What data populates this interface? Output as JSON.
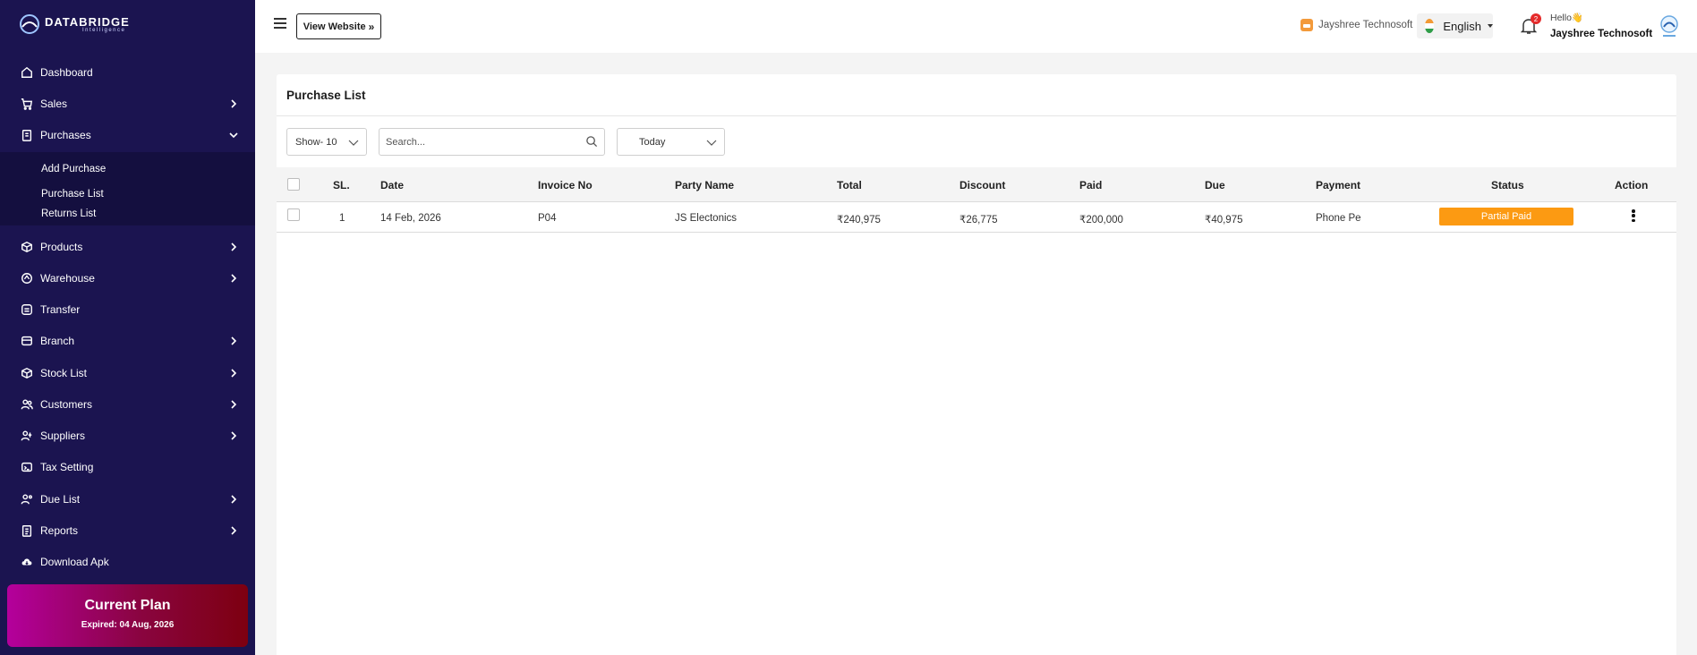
{
  "brand": {
    "name": "DATABRIDGE",
    "tagline": "Intelligence"
  },
  "sidebar": {
    "items": [
      {
        "label": "Dashboard",
        "icon": "home-icon"
      },
      {
        "label": "Sales",
        "icon": "cart-icon"
      },
      {
        "label": "Purchases",
        "icon": "clipboard-icon"
      },
      {
        "label": "Products",
        "icon": "box-icon"
      },
      {
        "label": "Warehouse",
        "icon": "warehouse-icon"
      },
      {
        "label": "Transfer",
        "icon": "transfer-icon"
      },
      {
        "label": "Branch",
        "icon": "branch-icon"
      },
      {
        "label": "Stock List",
        "icon": "cube-icon"
      },
      {
        "label": "Customers",
        "icon": "customers-icon"
      },
      {
        "label": "Suppliers",
        "icon": "suppliers-icon"
      },
      {
        "label": "Tax Setting",
        "icon": "tax-icon"
      },
      {
        "label": "Due List",
        "icon": "due-icon"
      },
      {
        "label": "Reports",
        "icon": "report-icon"
      },
      {
        "label": "Download Apk",
        "icon": "cloud-download-icon"
      }
    ],
    "purchases_submenu": [
      "Add Purchase",
      "Purchase List",
      "Returns List"
    ],
    "plan": {
      "title": "Current Plan",
      "expiry": "Expired: 04 Aug, 2026"
    }
  },
  "header": {
    "view_website_label": "View Website",
    "company": "Jayshree Technosoft",
    "language": "English",
    "notification_count": "2",
    "greeting": "Hello👋",
    "user_name": "Jayshree Technosoft"
  },
  "main": {
    "title": "Purchase List",
    "show_select": "Show- 10",
    "search_placeholder": "Search...",
    "date_filter": "Today",
    "columns": [
      "SL.",
      "Date",
      "Invoice No",
      "Party Name",
      "Total",
      "Discount",
      "Paid",
      "Due",
      "Payment",
      "Status",
      "Action"
    ],
    "rows": [
      {
        "sl": "1",
        "date": "14 Feb, 2026",
        "invoice": "P04",
        "party": "JS Electonics",
        "total": "₹240,975",
        "discount": "₹26,775",
        "paid": "₹200,000",
        "due": "₹40,975",
        "payment": "Phone Pe",
        "status": "Partial Paid"
      }
    ]
  },
  "colors": {
    "sidebar_bg": "#1b1450",
    "status_partial": "#fc9a12",
    "plan_start": "#b4009c",
    "plan_end": "#7d0010"
  }
}
